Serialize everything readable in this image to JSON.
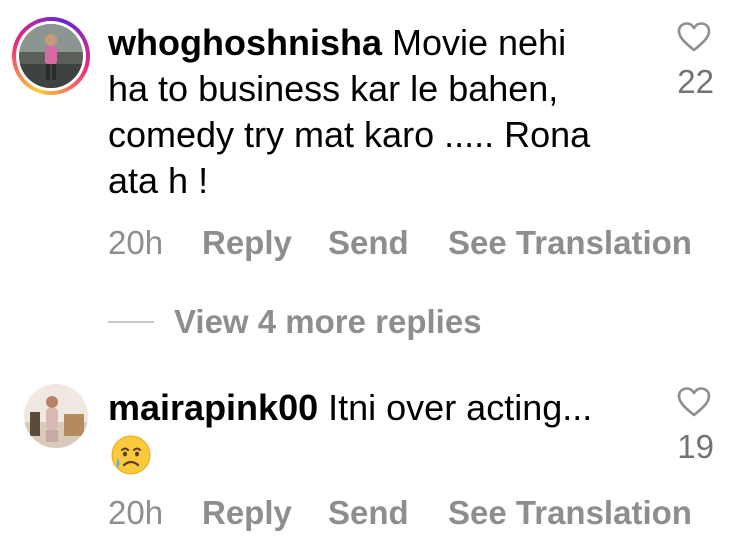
{
  "comments": [
    {
      "username": "whoghoshnisha",
      "text_line1": " Movie nehi",
      "text_line2": "ha to business kar le bahen,",
      "text_line3": "comedy try mat karo ..... Rona",
      "text_line4": "ata h !",
      "time": "20h",
      "reply_label": "Reply",
      "send_label": "Send",
      "translate_label": "See Translation",
      "likes": "22"
    },
    {
      "username": "mairapink00",
      "text_line1": " Itni over acting...",
      "emoji_icon": "crying-face-icon",
      "time": "20h",
      "reply_label": "Reply",
      "send_label": "Send",
      "translate_label": "See Translation",
      "likes": "19"
    }
  ],
  "thread": {
    "view_more_label": "View 4 more replies"
  },
  "colors": {
    "secondary_text": "#8e8e8e",
    "story_ring_start": "#f9ce34",
    "story_ring_mid": "#ee2a7b",
    "story_ring_end": "#6228d7"
  }
}
